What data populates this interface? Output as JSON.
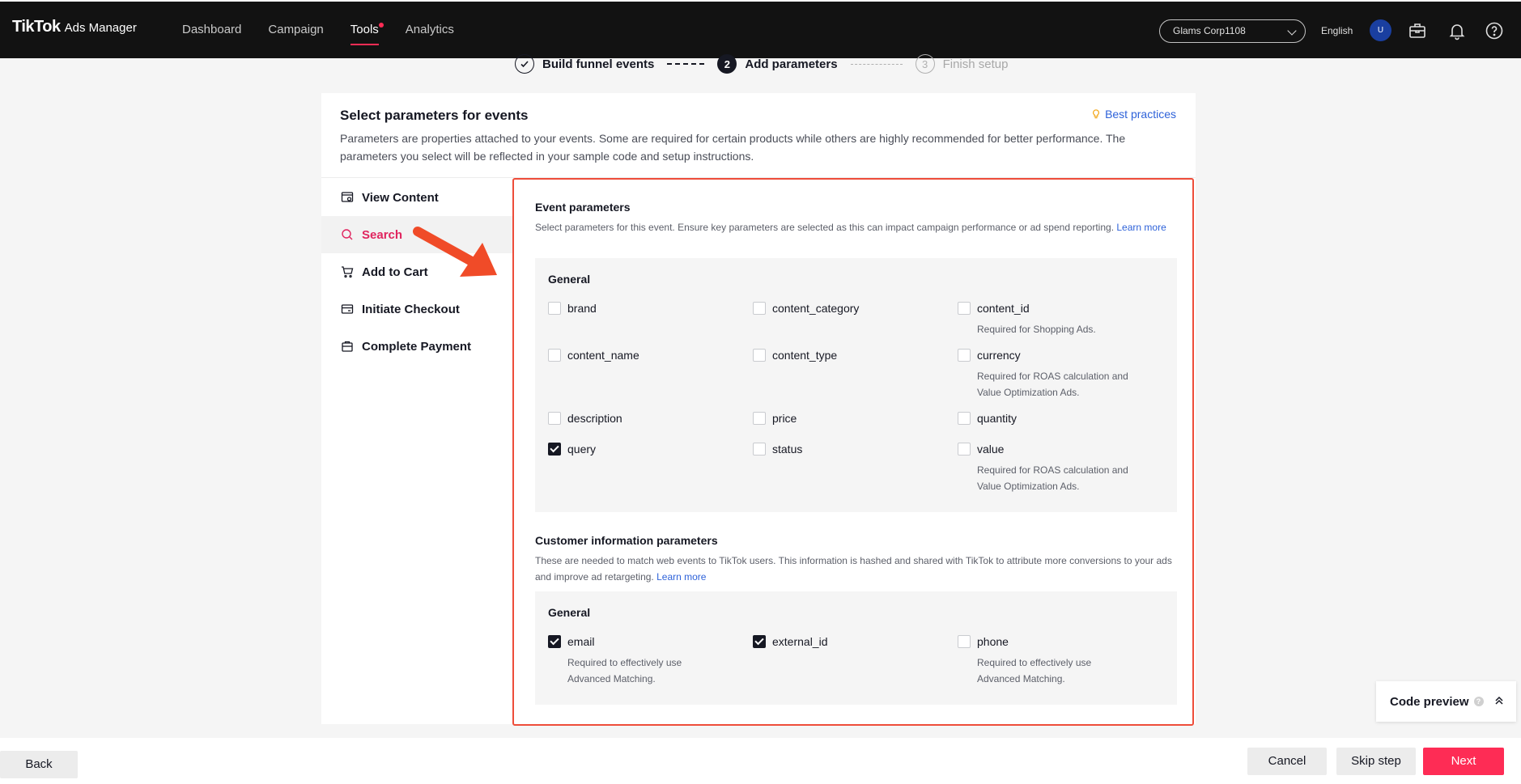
{
  "header": {
    "brand": "TikTok",
    "brand_sub": "Ads Manager",
    "nav": [
      {
        "label": "Dashboard"
      },
      {
        "label": "Campaign"
      },
      {
        "label": "Tools"
      },
      {
        "label": "Analytics"
      }
    ],
    "active_nav": "Tools",
    "account": "Glams Corp1108",
    "language": "English",
    "avatar_initial": "U",
    "icons": [
      "toolbox-icon",
      "bell-icon",
      "help-icon"
    ]
  },
  "stepper": {
    "steps": [
      {
        "number": "1",
        "label": "Build funnel events",
        "state": "done"
      },
      {
        "number": "2",
        "label": "Add parameters",
        "state": "current"
      },
      {
        "number": "3",
        "label": "Finish setup",
        "state": "pending"
      }
    ]
  },
  "card": {
    "title": "Select parameters for events",
    "best_practices": "Best practices",
    "description": "Parameters are properties attached to your events. Some are required for certain products while others are highly recommended for better performance. The parameters you select will be reflected in your sample code and setup instructions."
  },
  "sidebar": {
    "items": [
      {
        "label": "View Content",
        "icon": "view-content-icon"
      },
      {
        "label": "Search",
        "icon": "search-icon"
      },
      {
        "label": "Add to Cart",
        "icon": "cart-icon"
      },
      {
        "label": "Initiate Checkout",
        "icon": "checkout-icon"
      },
      {
        "label": "Complete Payment",
        "icon": "payment-icon"
      }
    ],
    "active": "Search"
  },
  "event_params": {
    "title": "Event parameters",
    "description": "Select parameters for this event. Ensure key parameters are selected as this can impact campaign performance or ad spend reporting.",
    "learn_more": "Learn more",
    "group_title": "General",
    "params": [
      {
        "name": "brand",
        "checked": false
      },
      {
        "name": "content_category",
        "checked": false
      },
      {
        "name": "content_id",
        "checked": false,
        "note": "Required for Shopping Ads."
      },
      {
        "name": "content_name",
        "checked": false
      },
      {
        "name": "content_type",
        "checked": false
      },
      {
        "name": "currency",
        "checked": false,
        "note": "Required for ROAS calculation and Value Optimization Ads."
      },
      {
        "name": "description",
        "checked": false
      },
      {
        "name": "price",
        "checked": false
      },
      {
        "name": "quantity",
        "checked": false
      },
      {
        "name": "query",
        "checked": true
      },
      {
        "name": "status",
        "checked": false
      },
      {
        "name": "value",
        "checked": false,
        "note": "Required for ROAS calculation and Value Optimization Ads."
      }
    ]
  },
  "customer_params": {
    "title": "Customer information parameters",
    "description": "These are needed to match web events to TikTok users. This information is hashed and shared with TikTok to attribute more conversions to your ads and improve ad retargeting.",
    "learn_more": "Learn more",
    "group_title": "General",
    "params": [
      {
        "name": "email",
        "checked": true,
        "note": "Required to effectively use Advanced Matching."
      },
      {
        "name": "external_id",
        "checked": true
      },
      {
        "name": "phone",
        "checked": false,
        "note": "Required to effectively use Advanced Matching."
      }
    ]
  },
  "code_preview": {
    "label": "Code preview",
    "help": "?"
  },
  "footer": {
    "back": "Back",
    "cancel": "Cancel",
    "skip": "Skip step",
    "next": "Next"
  },
  "colors": {
    "accent": "#fe2c55",
    "highlight_border": "#ee4d3a",
    "link": "#2e62d9",
    "topbar": "#121212"
  }
}
